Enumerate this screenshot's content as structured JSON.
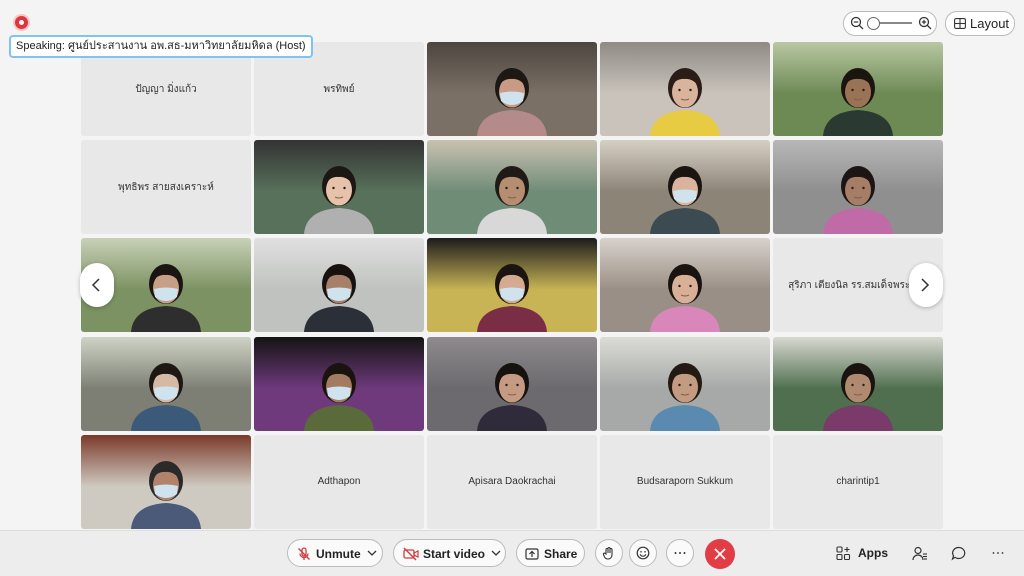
{
  "speaking": {
    "text": "Speaking: ศูนย์ประสานงาน อพ.สธ-มหาวิทยาลัยมหิดล (Host)"
  },
  "top_right": {
    "layout_label": "Layout"
  },
  "participants": [
    {
      "name": "ปัญญา มิ่งแก้ว",
      "video": false
    },
    {
      "name": "พรทิพย์",
      "video": false
    },
    {
      "name": "",
      "video": true,
      "bg": "#7a7066",
      "top": "#4d463f",
      "skin": "#c99b84",
      "hair": "#1e1815",
      "shirt": "#b58a8a",
      "mask": true
    },
    {
      "name": "",
      "video": true,
      "bg": "#c9c3bc",
      "top": "#8f8a84",
      "skin": "#d9b39c",
      "hair": "#2a1d18",
      "shirt": "#e7cb42",
      "mask": false
    },
    {
      "name": "",
      "video": true,
      "bg": "#6d8a55",
      "top": "#b9c7a2",
      "skin": "#9a7356",
      "hair": "#1b1510",
      "shirt": "#2a3a33",
      "mask": false
    },
    {
      "name": "พุทธิพร สายสงเคราะห์",
      "video": false
    },
    {
      "name": "",
      "video": true,
      "bg": "#57715b",
      "top": "#333",
      "skin": "#e6c2aa",
      "hair": "#1c1713",
      "shirt": "#b0b0b0",
      "mask": false
    },
    {
      "name": "",
      "video": true,
      "bg": "#6f8c77",
      "top": "#c9c2b0",
      "skin": "#b58d70",
      "hair": "#201a16",
      "shirt": "#d8d8d8",
      "mask": false
    },
    {
      "name": "",
      "video": true,
      "bg": "#8c8477",
      "top": "#d6cfc4",
      "skin": "#d9b39d",
      "hair": "#1b1511",
      "shirt": "#3c4a52",
      "mask": true
    },
    {
      "name": "",
      "video": true,
      "bg": "#8f8f8f",
      "top": "#b7b7b7",
      "skin": "#a67d65",
      "hair": "#1c1513",
      "shirt": "#c06aa8",
      "mask": false
    },
    {
      "name": "",
      "video": true,
      "bg": "#7c9262",
      "top": "#c8d1b8",
      "skin": "#c79e86",
      "hair": "#1a1512",
      "shirt": "#2e2e2e",
      "mask": true
    },
    {
      "name": "",
      "video": true,
      "bg": "#bfc2bf",
      "top": "#e0e0e0",
      "skin": "#a8806a",
      "hair": "#17120f",
      "shirt": "#2b3038",
      "mask": true
    },
    {
      "name": "",
      "video": true,
      "bg": "#c8b454",
      "top": "#1c1c1c",
      "skin": "#d4ab90",
      "hair": "#1b1410",
      "shirt": "#7a2d45",
      "mask": true
    },
    {
      "name": "",
      "video": true,
      "bg": "#9a8f86",
      "top": "#d8d2cc",
      "skin": "#d7b097",
      "hair": "#1a1411",
      "shirt": "#d987bb",
      "mask": false
    },
    {
      "name": "สุริภา เตียงนิล รร.สมเด็จพระปิยะ",
      "video": false
    },
    {
      "name": "",
      "video": true,
      "bg": "#7d7f74",
      "top": "#cfd3c5",
      "skin": "#d6b9a5",
      "hair": "#1e1814",
      "shirt": "#3b5a7a",
      "mask": true
    },
    {
      "name": "",
      "video": true,
      "bg": "#6e3a7c",
      "top": "#141414",
      "skin": "#a47a60",
      "hair": "#1a1310",
      "shirt": "#5a6a3a",
      "mask": true
    },
    {
      "name": "",
      "video": true,
      "bg": "#6c6a6e",
      "top": "#8e8a8e",
      "skin": "#c49a83",
      "hair": "#18120f",
      "shirt": "#2f2b3a",
      "mask": false
    },
    {
      "name": "",
      "video": true,
      "bg": "#a6a9a8",
      "top": "#dcdcd6",
      "skin": "#c29b80",
      "hair": "#231a14",
      "shirt": "#5a8ab0",
      "mask": false
    },
    {
      "name": "",
      "video": true,
      "bg": "#4f6f4f",
      "top": "#d8d8d0",
      "skin": "#b08a70",
      "hair": "#1a1411",
      "shirt": "#7a3a6a",
      "mask": false
    },
    {
      "name": "",
      "video": true,
      "bg": "#cfcac1",
      "top": "#7a3a2a",
      "skin": "#b0836a",
      "hair": "#2a2a2a",
      "shirt": "#4c5a7a",
      "mask": true
    },
    {
      "name": "Adthapon",
      "video": false
    },
    {
      "name": "Apisara Daokrachai",
      "video": false
    },
    {
      "name": "Budsaraporn Sukkum",
      "video": false
    },
    {
      "name": "charintip1",
      "video": false
    }
  ],
  "toolbar": {
    "unmute_label": "Unmute",
    "start_video_label": "Start video",
    "share_label": "Share",
    "apps_label": "Apps"
  }
}
